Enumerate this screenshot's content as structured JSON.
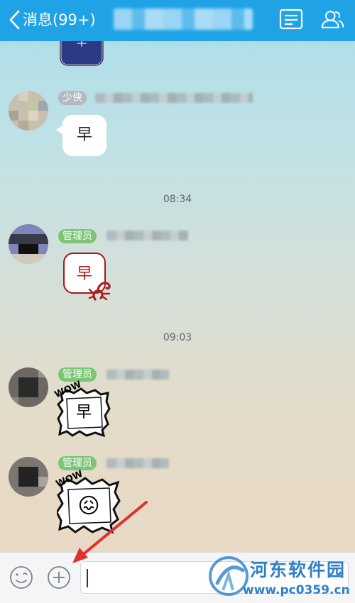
{
  "header": {
    "back_label": "消息(99+)",
    "info_icon": "chat-info-icon",
    "group_icon": "group-members-icon"
  },
  "messages": [
    {
      "badge": "少侠",
      "badge_color": "gray",
      "content": "早",
      "type": "text"
    },
    {
      "time": "08:34"
    },
    {
      "badge": "管理员",
      "badge_color": "green",
      "content": "早",
      "type": "sticker-scorpion"
    },
    {
      "time": "09:03"
    },
    {
      "badge": "管理员",
      "badge_color": "green",
      "content": "早",
      "type": "sticker-wow"
    },
    {
      "badge": "管理员",
      "badge_color": "green",
      "content": "😖",
      "type": "sticker-wow-emoji",
      "sticker_caption": "WOW"
    }
  ],
  "sticker_captions": {
    "wow1": "WOW",
    "wow2": "WOW"
  },
  "input": {
    "placeholder": "",
    "value": ""
  },
  "toolbar": {
    "emoji_icon": "emoji-icon",
    "plus_icon": "add-plus-icon"
  },
  "watermark": {
    "title": "河东软件园",
    "url": "www.pc0359.cn"
  },
  "colors": {
    "header": "#1fa3e6",
    "badge_admin": "#7cc576",
    "badge_member": "#b3b9bf",
    "arrow": "#e0312e",
    "watermark": "#2f7fc9"
  }
}
